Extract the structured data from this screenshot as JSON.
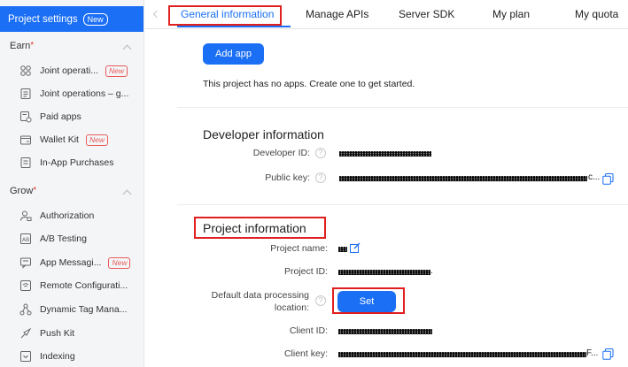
{
  "sidebar": {
    "header": {
      "label": "Project settings",
      "badge": "New"
    },
    "groups": [
      {
        "label": "Earn",
        "items": [
          {
            "label": "Joint operati...",
            "badge": "New",
            "icon": "joint-operations-icon"
          },
          {
            "label": "Joint operations – g...",
            "icon": "document-icon"
          },
          {
            "label": "Paid apps",
            "icon": "paid-apps-icon"
          },
          {
            "label": "Wallet Kit",
            "badge": "New",
            "icon": "wallet-icon"
          },
          {
            "label": "In-App Purchases",
            "icon": "purchase-icon"
          }
        ]
      },
      {
        "label": "Grow",
        "items": [
          {
            "label": "Authorization",
            "icon": "authorization-icon"
          },
          {
            "label": "A/B Testing",
            "icon": "ab-testing-icon"
          },
          {
            "label": "App Messagi...",
            "badge": "New",
            "icon": "message-icon"
          },
          {
            "label": "Remote Configurati...",
            "icon": "remote-config-icon"
          },
          {
            "label": "Dynamic Tag Mana...",
            "icon": "tag-manager-icon"
          },
          {
            "label": "Push Kit",
            "icon": "push-icon"
          },
          {
            "label": "Indexing",
            "icon": "indexing-icon"
          }
        ]
      }
    ]
  },
  "tabs": [
    "General information",
    "Manage APIs",
    "Server SDK",
    "My plan",
    "My quota"
  ],
  "apps": {
    "add_button": "Add app",
    "empty_text": "This project has no apps. Create one to get started."
  },
  "developer": {
    "title": "Developer information",
    "developer_id_label": "Developer ID:",
    "public_key_label": "Public key:",
    "public_key_suffix": "c..."
  },
  "project": {
    "title": "Project information",
    "name_label": "Project name:",
    "id_label": "Project ID:",
    "id_suffix": ".",
    "location_label_1": "Default data processing",
    "location_label_2": "location:",
    "set_button": "Set",
    "client_id_label": "Client ID:",
    "client_key_label": "Client key:",
    "client_key_suffix": "F..."
  },
  "colors": {
    "accent": "#1b6ff5",
    "highlight": "#e01f1f",
    "new_badge": "#e85b5b"
  }
}
